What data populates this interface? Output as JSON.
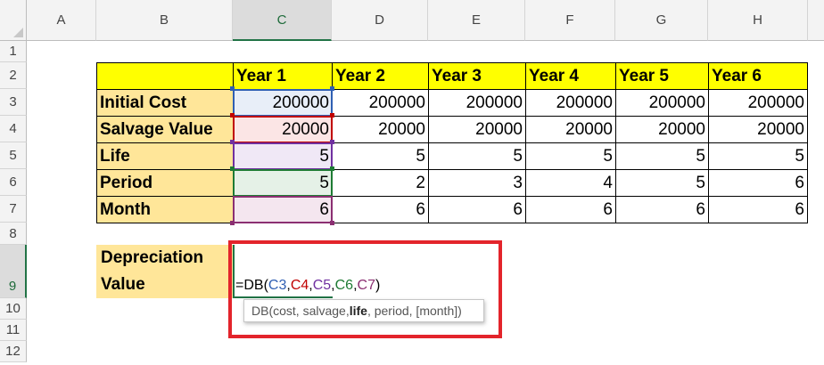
{
  "columns": [
    "A",
    "B",
    "C",
    "D",
    "E",
    "F",
    "G",
    "H"
  ],
  "rows": [
    "1",
    "2",
    "3",
    "4",
    "5",
    "6",
    "7",
    "8",
    "9",
    "10",
    "11",
    "12"
  ],
  "table": {
    "headers": [
      "Year 1",
      "Year 2",
      "Year 3",
      "Year 4",
      "Year 5",
      "Year 6"
    ],
    "row_labels": [
      "Initial Cost",
      "Salvage Value",
      "Life",
      "Period",
      "Month"
    ],
    "values": [
      [
        "200000",
        "200000",
        "200000",
        "200000",
        "200000",
        "200000"
      ],
      [
        "20000",
        "20000",
        "20000",
        "20000",
        "20000",
        "20000"
      ],
      [
        "5",
        "5",
        "5",
        "5",
        "5",
        "5"
      ],
      [
        "5",
        "2",
        "3",
        "4",
        "5",
        "6"
      ],
      [
        "6",
        "6",
        "6",
        "6",
        "6",
        "6"
      ]
    ]
  },
  "depreciation": {
    "label_line1": "Depreciation",
    "label_line2": "Value"
  },
  "formula": {
    "prefix": "=DB(",
    "args": [
      "C3",
      "C4",
      "C5",
      "C6",
      "C7"
    ],
    "separator": ",",
    "suffix": ")"
  },
  "tooltip": {
    "prefix": "DB(cost, salvage, ",
    "bold": "life",
    "suffix": ", period, [month])"
  },
  "colors": {
    "header_fill": "#ffff00",
    "label_fill": "#ffe699",
    "highlight_red": "#e3242b",
    "ref_c3": "#2f5fb3",
    "ref_c4": "#c00000",
    "ref_c5": "#7030a0",
    "ref_c6": "#1e7b34",
    "ref_c7": "#8b2f72"
  }
}
